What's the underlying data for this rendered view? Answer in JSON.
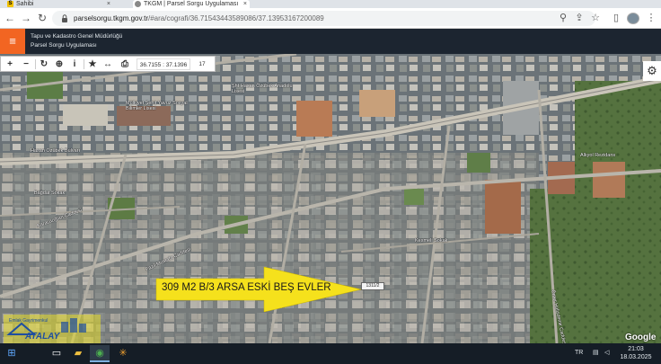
{
  "tabs": [
    {
      "label": "Sahibi",
      "favicon_letter": "S"
    },
    {
      "label": "TKGM | Parsel Sorgu Uygulaması"
    }
  ],
  "address": {
    "host": "parselsorgu.tkgm.gov.tr",
    "path": "/#ara/cografi/36.71543443589086/37.13953167200089"
  },
  "header": {
    "line1": "Tapu ve Kadastro Genel Müdürlüğü",
    "line2": "Parsel Sorgu Uygulaması"
  },
  "toolbar": {
    "coordinates": "36.7155 : 37.1396",
    "zoom": "17",
    "info_label": "i"
  },
  "map_labels": [
    {
      "text": "Hasan Özübek Bulvarı"
    },
    {
      "text": "Şht Hasan Özübek Anadolu Lisesi"
    },
    {
      "text": "Mülkiyet Şehit Yavuz Sosyal Bilimler Lisesi"
    },
    {
      "text": "Karacaoğlan Caddesi"
    },
    {
      "text": "Alkyol Rezidans"
    },
    {
      "text": "Kesmeli Sokak"
    },
    {
      "text": "Ömer Halisdemir Caddesi"
    },
    {
      "text": "Fazıl Mustafa Caddesi"
    },
    {
      "text": "Bağdat Sokak"
    }
  ],
  "annotation": {
    "text": "309 M2 B/3 ARSA ESKİ BEŞ EVLER",
    "parcel_no": "1311/2"
  },
  "watermark": {
    "brand": "ATALAY",
    "subtitle": "Emlak Gayrimenkul",
    "colors": {
      "bg": "#e6dc28",
      "text": "#1f4fa0"
    }
  },
  "taskbar": {
    "lang": "TR",
    "time": "21:03",
    "date": "18.03.2025"
  },
  "colors": {
    "accent": "#f26522",
    "header_bg": "#1c2530",
    "arrow": "#f5e11c"
  },
  "google_label": "Google"
}
